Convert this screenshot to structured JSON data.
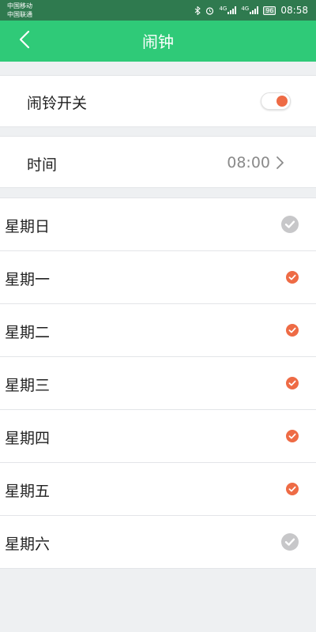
{
  "status_bar": {
    "carrier_1": "中国移动",
    "carrier_2": "中国联通",
    "bluetooth_icon": "bluetooth",
    "alarm_icon": "alarm-clock",
    "network_1": "4G",
    "network_2": "4G",
    "battery": "96",
    "time": "08:58"
  },
  "header": {
    "title": "闹钟",
    "back_icon": "chevron-left"
  },
  "alarm_switch": {
    "label": "闹铃开关",
    "enabled": true,
    "accent": "#ee6b45"
  },
  "time_setting": {
    "label": "时间",
    "value": "08:00"
  },
  "colors": {
    "header_bg": "#2fca78",
    "checked": "#ee6b45",
    "unchecked": "#c7c7c9"
  },
  "days": [
    {
      "label": "星期日",
      "checked": false
    },
    {
      "label": "星期一",
      "checked": true
    },
    {
      "label": "星期二",
      "checked": true
    },
    {
      "label": "星期三",
      "checked": true
    },
    {
      "label": "星期四",
      "checked": true
    },
    {
      "label": "星期五",
      "checked": true
    },
    {
      "label": "星期六",
      "checked": false
    }
  ]
}
